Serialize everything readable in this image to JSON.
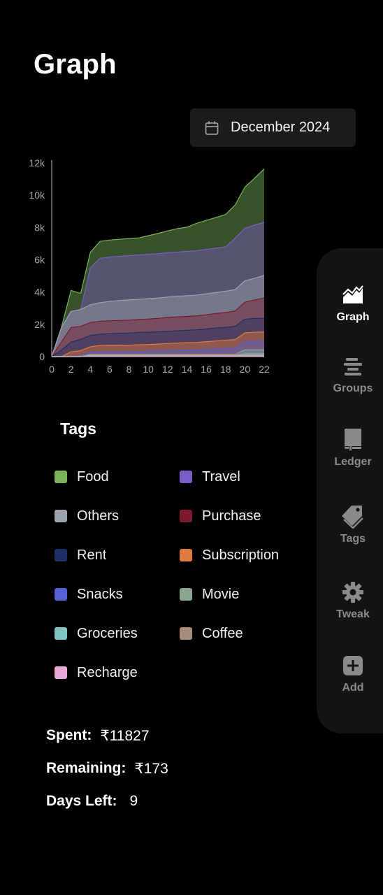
{
  "header": {
    "title": "Graph"
  },
  "month_picker": {
    "label": "December 2024"
  },
  "chart_data": {
    "type": "area",
    "stacked": true,
    "title": "",
    "xlabel": "",
    "ylabel": "",
    "x": [
      0,
      1,
      2,
      3,
      4,
      5,
      6,
      7,
      8,
      9,
      10,
      11,
      12,
      13,
      14,
      15,
      16,
      17,
      18,
      19,
      20,
      21,
      22
    ],
    "xlim": [
      0,
      22
    ],
    "ylim": [
      0,
      12000
    ],
    "x_ticks": [
      0,
      2,
      4,
      6,
      8,
      10,
      12,
      14,
      16,
      18,
      20,
      22
    ],
    "y_ticks": [
      0,
      2000,
      4000,
      6000,
      8000,
      10000,
      12000
    ],
    "y_tick_labels": [
      "0",
      "2k",
      "4k",
      "6k",
      "8k",
      "10k",
      "12k"
    ],
    "grid": false,
    "series": [
      {
        "name": "Recharge",
        "color": "#e8a9d8",
        "values": [
          0,
          0,
          0,
          0,
          50,
          50,
          50,
          50,
          50,
          50,
          50,
          50,
          50,
          50,
          50,
          50,
          50,
          50,
          50,
          50,
          50,
          50,
          50
        ]
      },
      {
        "name": "Coffee",
        "color": "#a88a7a",
        "values": [
          0,
          0,
          0,
          0,
          40,
          40,
          40,
          40,
          40,
          40,
          40,
          40,
          40,
          40,
          40,
          40,
          40,
          40,
          40,
          40,
          40,
          40,
          40
        ]
      },
      {
        "name": "Groceries",
        "color": "#7fc4c0",
        "values": [
          0,
          0,
          0,
          0,
          0,
          0,
          0,
          0,
          0,
          0,
          0,
          0,
          0,
          0,
          0,
          0,
          0,
          0,
          0,
          0,
          80,
          80,
          80
        ]
      },
      {
        "name": "Movie",
        "color": "#8aa68c",
        "values": [
          0,
          0,
          0,
          0,
          50,
          50,
          50,
          50,
          50,
          50,
          50,
          50,
          50,
          50,
          50,
          50,
          50,
          50,
          50,
          50,
          250,
          250,
          250
        ]
      },
      {
        "name": "Snacks",
        "color": "#5360d6",
        "values": [
          0,
          0,
          20,
          40,
          120,
          150,
          160,
          160,
          170,
          180,
          190,
          210,
          230,
          250,
          260,
          270,
          300,
          330,
          350,
          380,
          500,
          530,
          550
        ]
      },
      {
        "name": "Subscription",
        "color": "#e07a3a",
        "values": [
          0,
          0,
          280,
          330,
          350,
          400,
          400,
          400,
          400,
          420,
          420,
          430,
          440,
          450,
          460,
          470,
          480,
          500,
          520,
          540,
          550,
          560,
          560
        ]
      },
      {
        "name": "Rent",
        "color": "#1e2f63",
        "values": [
          0,
          400,
          600,
          700,
          700,
          700,
          720,
          740,
          750,
          760,
          760,
          760,
          760,
          760,
          770,
          780,
          790,
          800,
          800,
          820,
          850,
          850,
          850
        ]
      },
      {
        "name": "Purchase",
        "color": "#7a1a2c",
        "values": [
          0,
          500,
          900,
          800,
          800,
          800,
          800,
          800,
          800,
          800,
          820,
          830,
          850,
          860,
          860,
          870,
          880,
          900,
          920,
          950,
          1050,
          1150,
          1250
        ]
      },
      {
        "name": "Others",
        "color": "#9da3ae",
        "values": [
          0,
          900,
          1000,
          1050,
          1100,
          1150,
          1200,
          1230,
          1250,
          1250,
          1260,
          1260,
          1270,
          1270,
          1280,
          1280,
          1300,
          1300,
          1320,
          1320,
          1330,
          1340,
          1400
        ]
      },
      {
        "name": "Travel",
        "color": "#7a5cc8",
        "values": [
          0,
          0,
          0,
          0,
          2300,
          2750,
          2750,
          2750,
          2750,
          2750,
          2750,
          2750,
          2750,
          2750,
          2750,
          2750,
          2750,
          2750,
          2750,
          3200,
          3250,
          3300,
          3300
        ]
      },
      {
        "name": "Food",
        "color": "#7bb35a",
        "values": [
          0,
          0,
          1300,
          1000,
          950,
          1050,
          1050,
          1050,
          1050,
          1050,
          1150,
          1250,
          1350,
          1450,
          1500,
          1700,
          1800,
          1900,
          2000,
          2050,
          2550,
          2900,
          3300
        ]
      }
    ]
  },
  "tags": {
    "title": "Tags",
    "items": [
      {
        "label": "Food",
        "color": "#7bb35a"
      },
      {
        "label": "Travel",
        "color": "#7a5cc8"
      },
      {
        "label": "Others",
        "color": "#9da3ae"
      },
      {
        "label": "Purchase",
        "color": "#7a1a2c"
      },
      {
        "label": "Rent",
        "color": "#1e2f63"
      },
      {
        "label": "Subscription",
        "color": "#e07a3a"
      },
      {
        "label": "Snacks",
        "color": "#5360d6"
      },
      {
        "label": "Movie",
        "color": "#8aa68c"
      },
      {
        "label": "Groceries",
        "color": "#7fc4c0"
      },
      {
        "label": "Coffee",
        "color": "#a88a7a"
      },
      {
        "label": "Recharge",
        "color": "#e8a9d8"
      }
    ]
  },
  "stats": {
    "spent_label": "Spent:",
    "spent_value": "₹11827",
    "remaining_label": "Remaining:",
    "remaining_value": "₹173",
    "days_left_label": "Days Left:",
    "days_left_value": "9"
  },
  "nav": {
    "items": [
      {
        "label": "Graph",
        "icon": "chart-icon",
        "active": true
      },
      {
        "label": "Groups",
        "icon": "list-icon",
        "active": false
      },
      {
        "label": "Ledger",
        "icon": "book-icon",
        "active": false
      },
      {
        "label": "Tags",
        "icon": "tag-icon",
        "active": false
      },
      {
        "label": "Tweak",
        "icon": "gear-icon",
        "active": false
      },
      {
        "label": "Add",
        "icon": "plus-icon",
        "active": false
      }
    ]
  }
}
